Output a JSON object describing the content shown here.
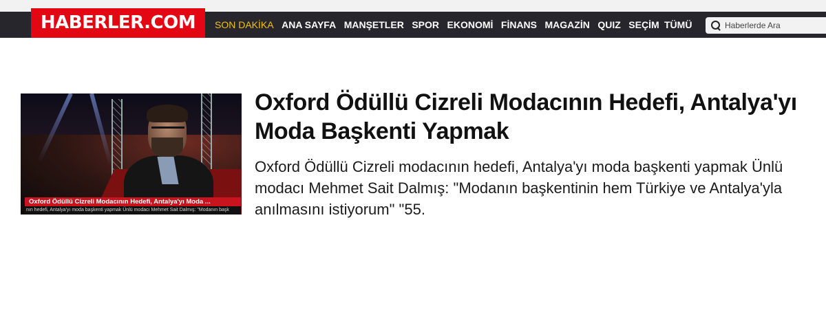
{
  "site": {
    "logo_text": "HABERLER.COM",
    "brand_color": "#e30613",
    "nav_bg": "#26262c"
  },
  "nav": {
    "items": [
      {
        "label": "SON DAKİKA",
        "active": true
      },
      {
        "label": "ANA SAYFA"
      },
      {
        "label": "MANŞETLER"
      },
      {
        "label": "SPOR"
      },
      {
        "label": "EKONOMİ"
      },
      {
        "label": "FİNANS"
      },
      {
        "label": "MAGAZİN"
      },
      {
        "label": "QUIZ"
      },
      {
        "label": "SEÇİM"
      }
    ],
    "all_label": "TÜMÜ"
  },
  "search": {
    "placeholder": "Haberlerde Ara",
    "icon": "search-icon"
  },
  "article": {
    "title": "Oxford Ödüllü Cizreli Modacının Hedefi, Antalya'yı Moda Başkenti Yapmak",
    "summary": "Oxford Ödüllü Cizreli modacının hedefi, Antalya'yı moda başkenti yapmak Ünlü modacı Mehmet Sait Dalmış: \"Modanın başkentinin hem Türkiye ve Antalya'yla anılmasını istiyorum\" \"55.",
    "thumb_caption": "Oxford Ödüllü Cizreli Modacının Hedefi, Antalya'yı Moda ...",
    "thumb_ticker": "nın hedefi, Antalya'yı moda başkenti yapmak Ünlü modacı Mehmet Sait Dalmış: \"Modanın başk"
  }
}
